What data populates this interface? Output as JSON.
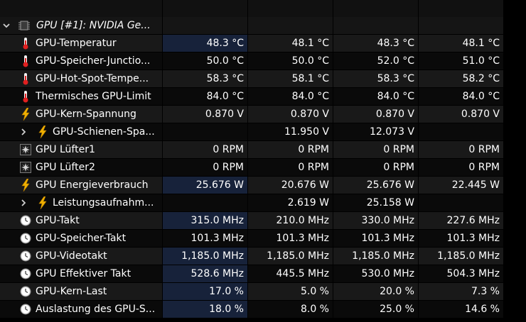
{
  "colors": {
    "background": "#000000",
    "row_dark": "#0a0a0a",
    "row_light": "#191919",
    "highlight": "#17223a",
    "text": "#ffffff",
    "thermo_red": "#e02020",
    "bolt_yellow": "#f0b000"
  },
  "group": {
    "label": "GPU [#1]: NVIDIA Ge...",
    "icon": "chip-icon",
    "expander": "chevron-down-icon"
  },
  "rows": [
    {
      "label": "GPU-Temperatur",
      "icon": "thermometer-icon",
      "values": [
        "48.3 °C",
        "48.1 °C",
        "48.3 °C",
        "48.1 °C"
      ],
      "hl": true
    },
    {
      "label": "GPU-Speicher-Junctio...",
      "icon": "thermometer-icon",
      "values": [
        "50.0 °C",
        "50.0 °C",
        "52.0 °C",
        "51.0 °C"
      ]
    },
    {
      "label": "GPU-Hot-Spot-Tempe...",
      "icon": "thermometer-icon",
      "values": [
        "58.3 °C",
        "58.1 °C",
        "58.3 °C",
        "58.2 °C"
      ]
    },
    {
      "label": "Thermisches GPU-Limit",
      "icon": "thermometer-icon",
      "values": [
        "84.0 °C",
        "84.0 °C",
        "84.0 °C",
        "84.0 °C"
      ]
    },
    {
      "label": "GPU-Kern-Spannung",
      "icon": "lightning-icon",
      "values": [
        "0.870 V",
        "0.870 V",
        "0.870 V",
        "0.870 V"
      ]
    },
    {
      "label": "GPU-Schienen-Spa...",
      "icon": "lightning-icon",
      "expandable": true,
      "values": [
        "",
        "11.950 V",
        "12.073 V",
        ""
      ]
    },
    {
      "label": "GPU Lüfter1",
      "icon": "fan-icon",
      "values": [
        "0 RPM",
        "0 RPM",
        "0 RPM",
        "0 RPM"
      ]
    },
    {
      "label": "GPU Lüfter2",
      "icon": "fan-icon",
      "values": [
        "0 RPM",
        "0 RPM",
        "0 RPM",
        "0 RPM"
      ]
    },
    {
      "label": "GPU Energieverbrauch",
      "icon": "lightning-icon",
      "values": [
        "25.676 W",
        "20.676 W",
        "25.676 W",
        "22.445 W"
      ],
      "hl": true
    },
    {
      "label": "Leistungsaufnahm...",
      "icon": "lightning-icon",
      "expandable": true,
      "values": [
        "",
        "2.619 W",
        "25.158 W",
        ""
      ]
    },
    {
      "label": "GPU-Takt",
      "icon": "clock-icon",
      "values": [
        "315.0 MHz",
        "210.0 MHz",
        "330.0 MHz",
        "227.6 MHz"
      ],
      "hl": true
    },
    {
      "label": "GPU-Speicher-Takt",
      "icon": "clock-icon",
      "values": [
        "101.3 MHz",
        "101.3 MHz",
        "101.3 MHz",
        "101.3 MHz"
      ]
    },
    {
      "label": "GPU-Videotakt",
      "icon": "clock-icon",
      "values": [
        "1,185.0 MHz",
        "1,185.0 MHz",
        "1,185.0 MHz",
        "1,185.0 MHz"
      ],
      "hl": true
    },
    {
      "label": "GPU Effektiver Takt",
      "icon": "clock-icon",
      "values": [
        "528.6 MHz",
        "445.5 MHz",
        "530.0 MHz",
        "504.3 MHz"
      ],
      "hl": true
    },
    {
      "label": "GPU-Kern-Last",
      "icon": "clock-icon",
      "values": [
        "17.0 %",
        "5.0 %",
        "20.0 %",
        "7.3 %"
      ],
      "hl": true
    },
    {
      "label": "Auslastung des GPU-S...",
      "icon": "clock-icon",
      "values": [
        "18.0 %",
        "8.0 %",
        "25.0 %",
        "14.6 %"
      ],
      "hl": true
    }
  ]
}
